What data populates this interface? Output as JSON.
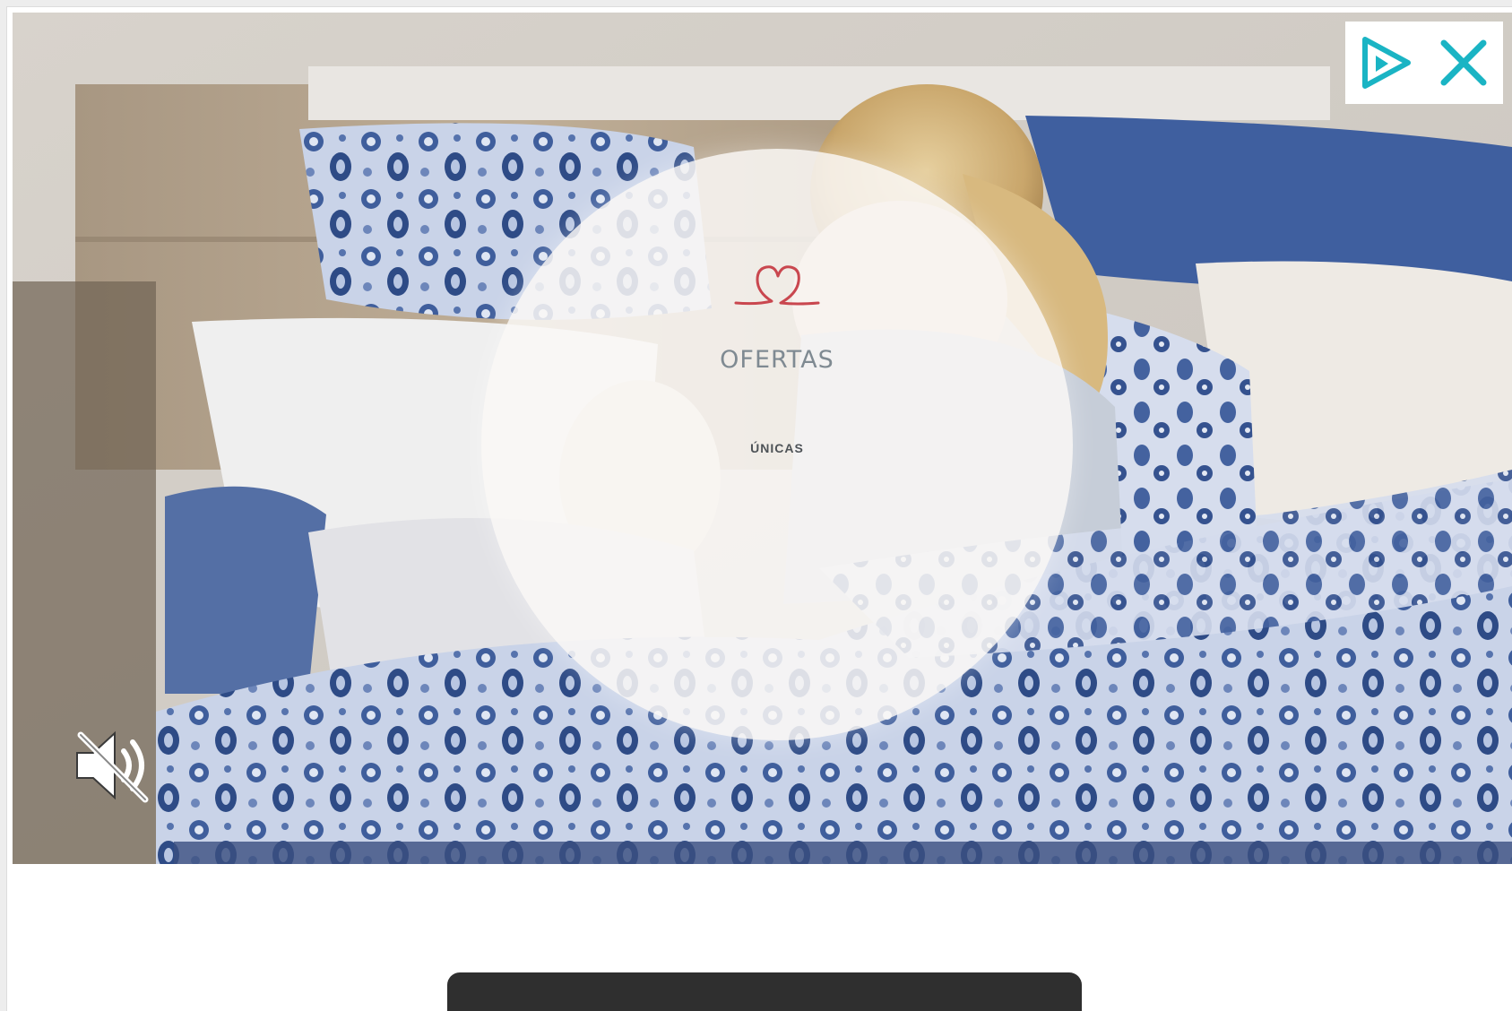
{
  "ad": {
    "promo": {
      "title": "OFERTAS",
      "subtitle": "ÚNICAS"
    },
    "cta": {
      "label": ""
    },
    "icons": {
      "adchoices": "adchoices-play-icon",
      "close": "close-icon",
      "mute": "speaker-muted-icon",
      "heart": "heart-logo-icon"
    },
    "colors": {
      "adchoices_accent": "#1ab4c4",
      "heart_accent": "#c9474f",
      "cta_background": "#2f2f2f"
    }
  }
}
